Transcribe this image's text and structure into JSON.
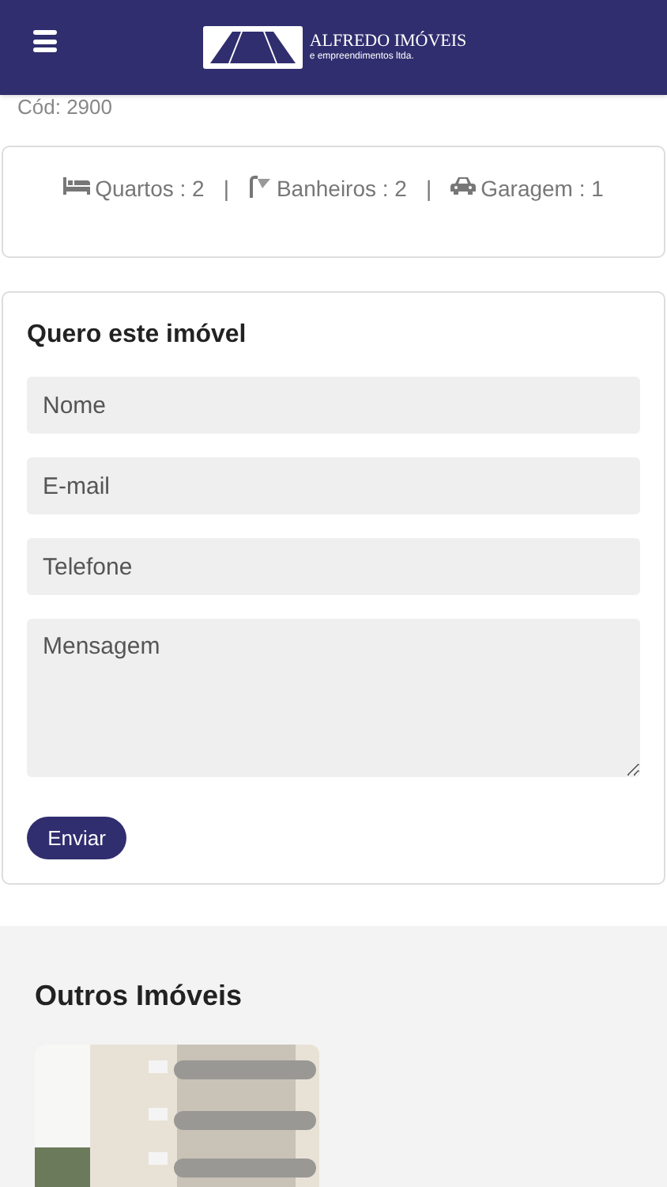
{
  "header": {
    "brand": "ALFREDO IMÓVEIS",
    "tagline": "e empreendimentos ltda."
  },
  "code": "Cód: 2900",
  "features": [
    {
      "kind": "bed",
      "label": "Quartos : 2"
    },
    {
      "kind": "separator",
      "label": "|"
    },
    {
      "kind": "shower",
      "label": "Banheiros : 2"
    },
    {
      "kind": "separator",
      "label": "|"
    },
    {
      "kind": "car",
      "label": "Garagem : 1"
    }
  ],
  "form": {
    "title": "Quero este imóvel",
    "fields": [
      {
        "kind": "input",
        "placeholder": "Nome"
      },
      {
        "kind": "input",
        "placeholder": "E-mail"
      },
      {
        "kind": "input",
        "placeholder": "Telefone"
      },
      {
        "kind": "textarea",
        "placeholder": "Mensagem"
      }
    ],
    "submit": "Enviar"
  },
  "others": {
    "title": "Outros Imóveis"
  }
}
